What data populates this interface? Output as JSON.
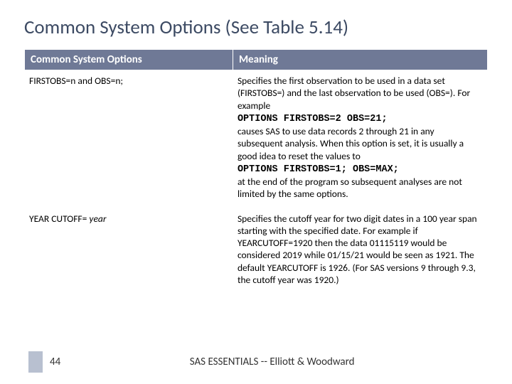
{
  "title": "Common System Options (See Table 5.14)",
  "table": {
    "headers": {
      "col1": "Common System Options",
      "col2": "Meaning"
    },
    "rows": [
      {
        "option": "FIRSTOBS=n and OBS=n;",
        "meaning_pre": "Specifies the first observation to be used in a data set (FIRSTOBS=) and the last observation to be used (OBS=). For example",
        "code1": "OPTIONS FIRSTOBS=2 OBS=21;",
        "meaning_mid": "causes SAS to use data records 2 through 21 in any subsequent analysis. When this option is set, it is usually a good idea to reset the values to",
        "code2": "OPTIONS FIRSTOBS=1; OBS=MAX;",
        "meaning_post": "at the end of the program so subsequent analyses are not limited by the same options."
      },
      {
        "option_pre": "YEAR CUTOFF= ",
        "option_ital": "year",
        "meaning": "Specifies the cutoff year for two digit dates in a 100 year span starting with the specified date. For example if YEARCUTOFF=1920 then the data 01115119 would be considered 2019 while 01/15/21 would be seen as 1921. The default YEARCUTOFF is 1926. (For SAS versions 9 through 9.3, the cutoff year was 1920.)"
      }
    ]
  },
  "footer": {
    "page": "44",
    "credit": "SAS ESSENTIALS -- Elliott & Woodward"
  }
}
